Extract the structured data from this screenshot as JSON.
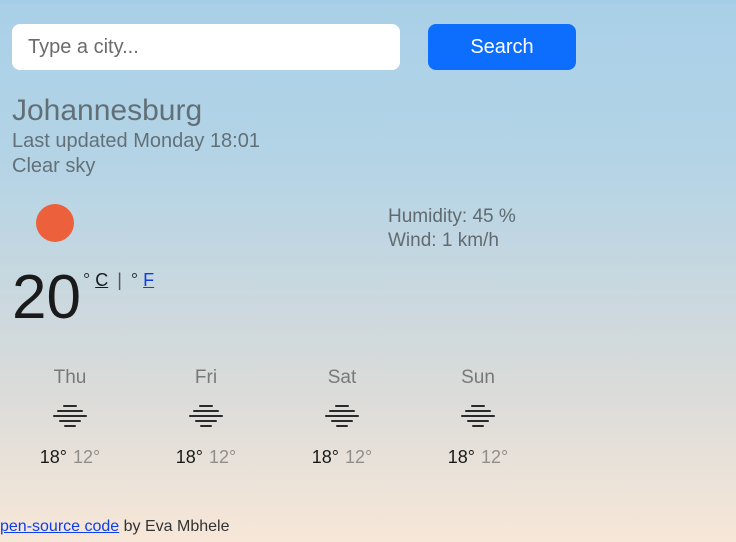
{
  "search": {
    "placeholder": "Type a city...",
    "button_label": "Search"
  },
  "city": "Johannesburg",
  "updated_prefix": "Last updated",
  "updated_day": "Monday",
  "updated_time": "18:01",
  "condition": "Clear sky",
  "current": {
    "temp": "20",
    "unit_c": "C",
    "unit_f": "F",
    "humidity_label": "Humidity:",
    "humidity_value": "45",
    "humidity_unit": "%",
    "wind_label": "Wind:",
    "wind_value": "1",
    "wind_unit": "km/h",
    "icon": "sun-icon"
  },
  "forecast": [
    {
      "day": "Thu",
      "hi": "18°",
      "lo": "12°",
      "icon": "fog-icon"
    },
    {
      "day": "Fri",
      "hi": "18°",
      "lo": "12°",
      "icon": "fog-icon"
    },
    {
      "day": "Sat",
      "hi": "18°",
      "lo": "12°",
      "icon": "fog-icon"
    },
    {
      "day": "Sun",
      "hi": "18°",
      "lo": "12°",
      "icon": "fog-icon"
    }
  ],
  "footer": {
    "link_text": "pen-source code",
    "by_text": " by Eva Mbhele"
  }
}
